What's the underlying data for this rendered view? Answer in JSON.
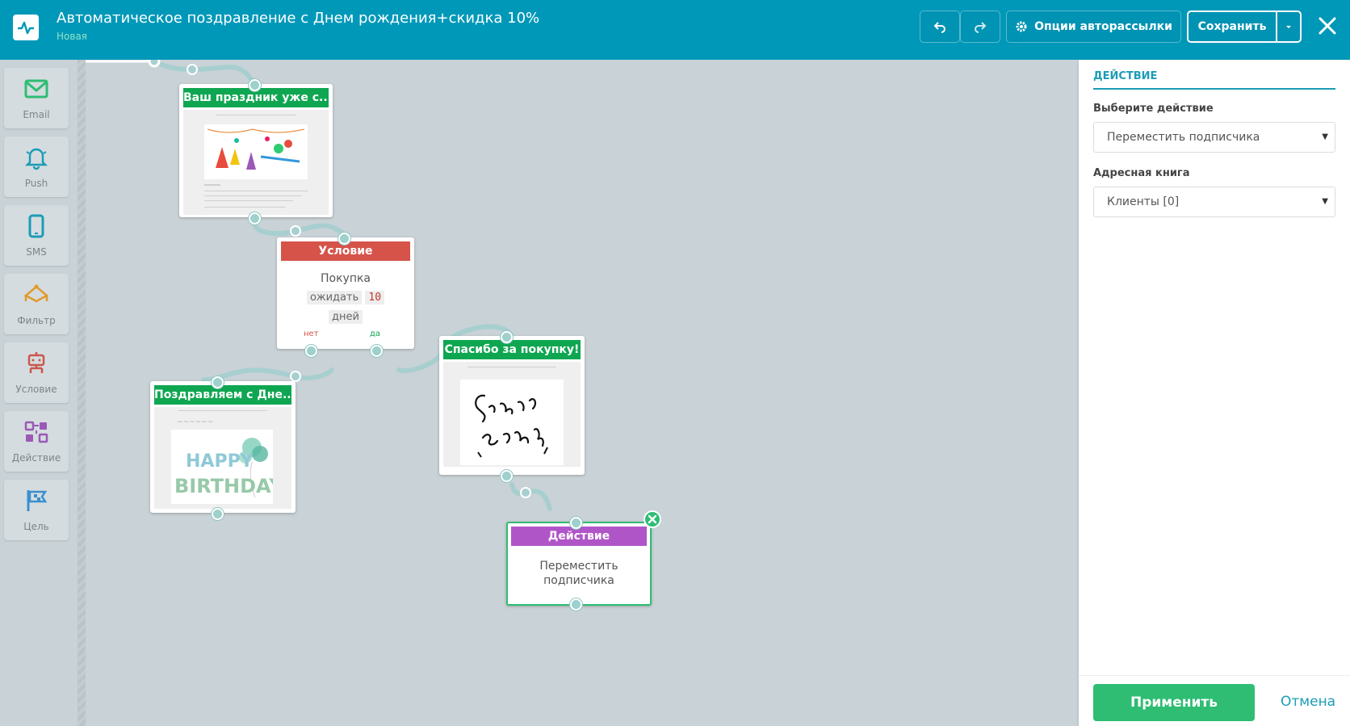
{
  "header": {
    "title": "Автоматическое поздравление с Днем рождения+скидка 10%",
    "status": "Новая",
    "options_label": "Опции авторассылки",
    "save_label": "Сохранить"
  },
  "sidebar": {
    "tools": [
      {
        "label": "Email",
        "icon": "envelope-icon",
        "color": "#2ebd73"
      },
      {
        "label": "Push",
        "icon": "bell-icon",
        "color": "#1b9cb6"
      },
      {
        "label": "SMS",
        "icon": "phone-icon",
        "color": "#1b9cb6"
      },
      {
        "label": "Фильтр",
        "icon": "filter-icon",
        "color": "#e09a2b"
      },
      {
        "label": "Условие",
        "icon": "condition-icon",
        "color": "#c9574d"
      },
      {
        "label": "Действие",
        "icon": "action-icon",
        "color": "#9b59b6"
      },
      {
        "label": "Цель",
        "icon": "flag-icon",
        "color": "#3b8fd0"
      }
    ]
  },
  "canvas": {
    "email1": {
      "title": "Ваш праздник уже с..."
    },
    "condition": {
      "title": "Условие",
      "event": "Покупка",
      "wait_label": "ожидать",
      "wait_value": "10",
      "unit": "дней",
      "no": "нет",
      "yes": "да"
    },
    "email2": {
      "title": "Поздравляем с Дне..."
    },
    "email3": {
      "title": "Спасибо за покупку!"
    },
    "action": {
      "title": "Действие",
      "text": "Переместить подписчика"
    }
  },
  "panel": {
    "title": "ДЕЙСТВИЕ",
    "action_label": "Выберите действие",
    "action_value": "Переместить подписчика",
    "book_label": "Адресная книга",
    "book_value": "Клиенты [0]",
    "apply": "Применить",
    "cancel": "Отмена"
  }
}
